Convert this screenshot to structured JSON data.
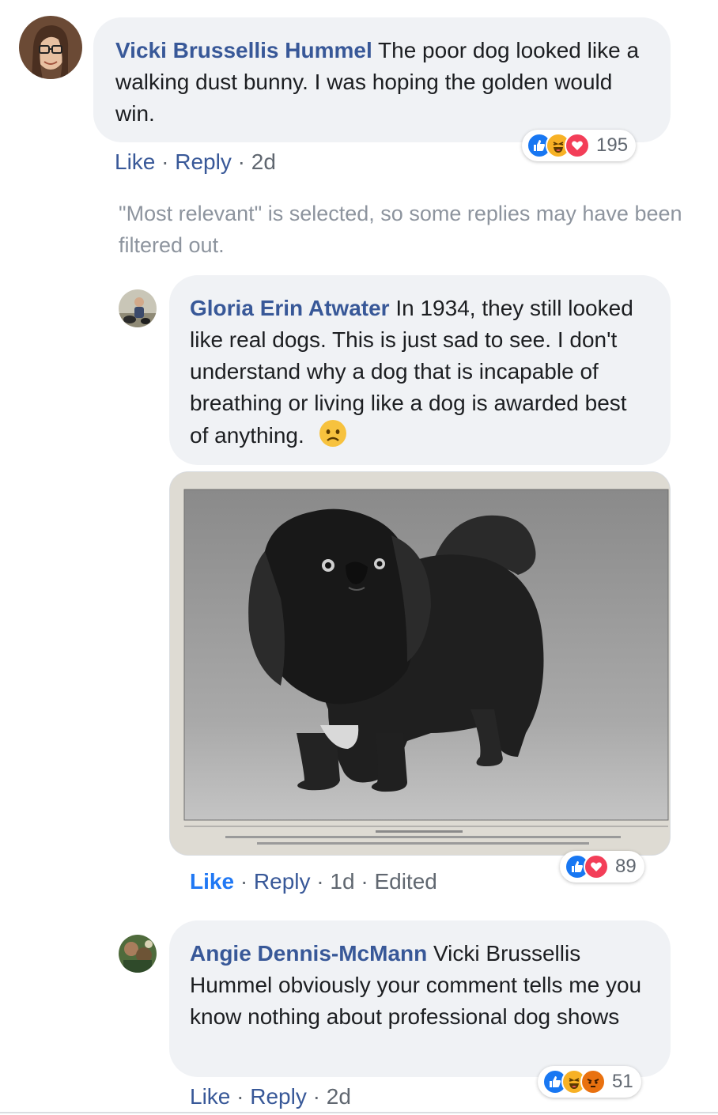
{
  "comment1": {
    "author": "Vicki Brussellis Hummel",
    "text": " The poor dog looked like a walking dust bunny. I was hoping the golden would win.",
    "like_label": "Like",
    "reply_label": "Reply",
    "time": "2d",
    "reaction_count": "195",
    "reactions": [
      "like-icon",
      "haha-icon",
      "love-icon"
    ]
  },
  "filter_note": "\"Most relevant\" is selected, so some replies may have been filtered out.",
  "reply1": {
    "author": "Gloria Erin Atwater",
    "text": " In 1934, they still looked like real dogs. This is just sad to see. I don't understand why a dog that is incapable of breathing or living like a dog is awarded best of anything.",
    "emoji": "sad-face-icon",
    "like_label": "Like",
    "reply_label": "Reply",
    "time": "1d",
    "edited_label": "Edited",
    "reaction_count": "89",
    "reactions": [
      "like-icon",
      "love-icon"
    ]
  },
  "reply2": {
    "author": "Angie Dennis-McMann",
    "text": " Vicki Brussellis Hummel obviously your comment tells me you know nothing about professional dog shows",
    "like_label": "Like",
    "reply_label": "Reply",
    "time": "2d",
    "reaction_count": "51",
    "reactions": [
      "like-icon",
      "haha-icon",
      "angry-icon"
    ]
  },
  "colors": {
    "bubble": "#f0f2f5",
    "author": "#385898",
    "like_active": "#2078f4",
    "meta": "#606770",
    "filter_note": "#8d949e"
  },
  "separator": "·"
}
